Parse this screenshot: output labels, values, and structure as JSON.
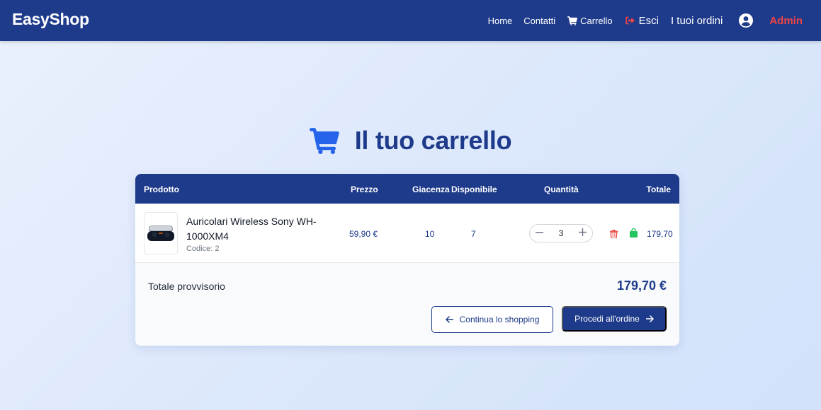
{
  "navbar": {
    "brand": "EasyShop",
    "home": "Home",
    "contatti": "Contatti",
    "carrello": "Carrello",
    "esci": "Esci",
    "ordini": "I tuoi ordini",
    "admin": "Admin"
  },
  "page": {
    "title": "Il tuo carrello"
  },
  "table": {
    "headers": {
      "prodotto": "Prodotto",
      "prezzo": "Prezzo",
      "giacenza": "Giacenza",
      "disponibile": "Disponibile",
      "quantita": "Quantità",
      "totale": "Totale"
    },
    "rows": [
      {
        "name": "Auricolari Wireless Sony WH-1000XM4",
        "code": "Codice: 2",
        "price": "59,90 €",
        "stock": "10",
        "available": "7",
        "quantity": "3",
        "total": "179,70"
      }
    ]
  },
  "summary": {
    "label": "Totale provvisorio",
    "value": "179,70 €",
    "continue_label": "Continua lo shopping",
    "order_label": "Procedi all'ordine"
  },
  "icons": {
    "cart": "shopping-cart",
    "logout": "sign-out",
    "user": "user-circle",
    "minus": "minus",
    "plus": "plus",
    "delete": "trash",
    "bag": "shopping-bag",
    "back": "arrow-left",
    "forward": "arrow-right"
  },
  "colors": {
    "primary": "#1e3a8a",
    "accent_blue": "#2563eb",
    "danger": "#ef4444",
    "success": "#22c55e"
  }
}
